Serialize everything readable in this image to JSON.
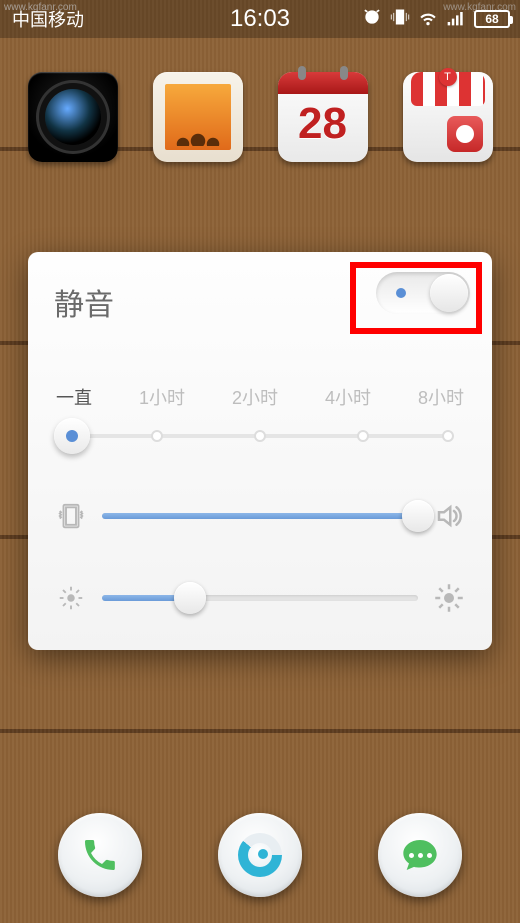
{
  "watermark_top": "www.kgfanr.com",
  "watermark_bottom": "www.kgfanr.com",
  "status": {
    "carrier": "中国移动",
    "time": "16:03",
    "battery": "68"
  },
  "home": {
    "calendar_day": "28",
    "store_badge": "T"
  },
  "panel": {
    "title": "静音",
    "duration_options": [
      "一直",
      "1小时",
      "2小时",
      "4小时",
      "8小时"
    ],
    "volume_percent": 100,
    "brightness_percent": 28
  },
  "colors": {
    "accent": "#5a8fd6",
    "highlight": "#ff0000"
  }
}
